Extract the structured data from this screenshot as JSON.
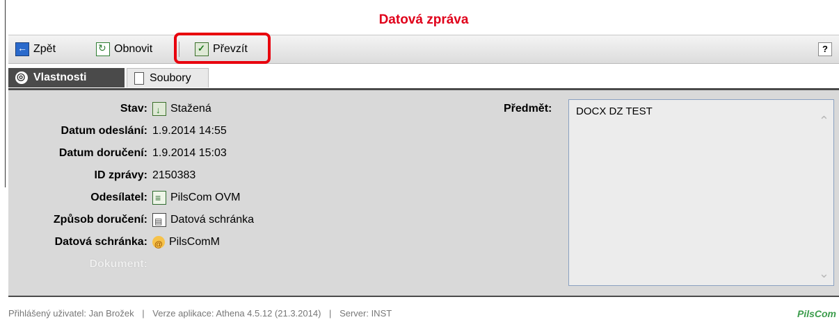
{
  "window": {
    "title": "Datová zpráva"
  },
  "toolbar": {
    "back_label": "Zpět",
    "refresh_label": "Obnovit",
    "take_label": "Převzít",
    "help_label": "?"
  },
  "tabs": [
    {
      "label": "Vlastnosti",
      "active": true
    },
    {
      "label": "Soubory",
      "active": false
    }
  ],
  "properties": {
    "stav": {
      "label": "Stav:",
      "value": "Stažená",
      "icon": "downloaded-icon"
    },
    "datum_odeslani": {
      "label": "Datum odeslání:",
      "value": "1.9.2014 14:55"
    },
    "datum_doruceni": {
      "label": "Datum doručení:",
      "value": "1.9.2014 15:03"
    },
    "id_zpravy": {
      "label": "ID zprávy:",
      "value": "2150383"
    },
    "odesilatel": {
      "label": "Odesílatel:",
      "value": "PilsCom OVM",
      "icon": "organization-icon"
    },
    "zpusob_doruceni": {
      "label": "Způsob doručení:",
      "value": "Datová schránka",
      "icon": "databox-delivery-icon"
    },
    "datova_schranka": {
      "label": "Datová schránka:",
      "value": "PilsComM",
      "icon": "databox-icon"
    },
    "dokument": {
      "label": "Dokument:",
      "value": ""
    },
    "predmet": {
      "label": "Předmět:",
      "value": "DOCX DZ TEST"
    }
  },
  "footer": {
    "user": "Přihlášený uživatel: Jan Brožek",
    "version": "Verze aplikace: Athena 4.5.12 (21.3.2014)",
    "server": "Server: INST",
    "separator": "|",
    "brand": "PilsCom"
  },
  "colors": {
    "title": "#e0001a",
    "highlight": "#e8000d",
    "active_tab": "#4a4a4a",
    "panel_bg": "#d9d9d9",
    "brand": "#3c9c4c"
  }
}
